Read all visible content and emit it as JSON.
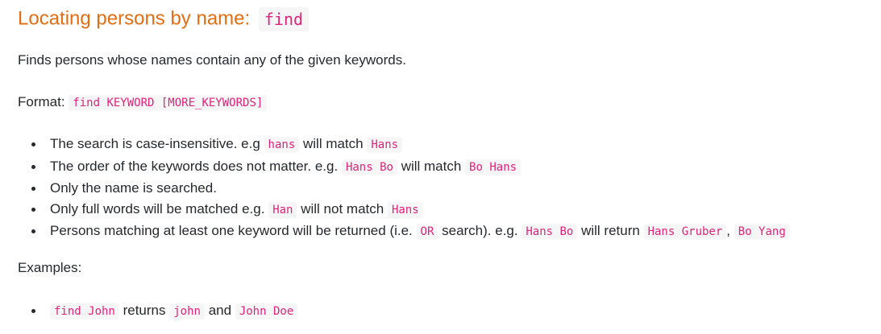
{
  "heading": {
    "text": "Locating persons by name:",
    "code": "find"
  },
  "description": "Finds persons whose names contain any of the given keywords.",
  "format": {
    "label": "Format:",
    "code": "find KEYWORD [MORE_KEYWORDS]"
  },
  "rules": [
    {
      "t1": "The search is case-insensitive. e.g",
      "c1": "hans",
      "t2": "will match",
      "c2": "Hans"
    },
    {
      "t1": "The order of the keywords does not matter. e.g.",
      "c1": "Hans Bo",
      "t2": "will match",
      "c2": "Bo Hans"
    },
    {
      "t1": "Only the name is searched."
    },
    {
      "t1": "Only full words will be matched e.g.",
      "c1": "Han",
      "t2": "will not match",
      "c2": "Hans"
    },
    {
      "t1": "Persons matching at least one keyword will be returned (i.e.",
      "c1": "OR",
      "t2": "search). e.g.",
      "c2": "Hans Bo",
      "t3": "will return",
      "c3": "Hans Gruber",
      "t4": ",",
      "c4": "Bo Yang"
    }
  ],
  "examples": {
    "label": "Examples:",
    "items": [
      {
        "c1": "find John",
        "t1": "returns",
        "c2": "john",
        "t2": "and",
        "c3": "John Doe"
      }
    ]
  }
}
